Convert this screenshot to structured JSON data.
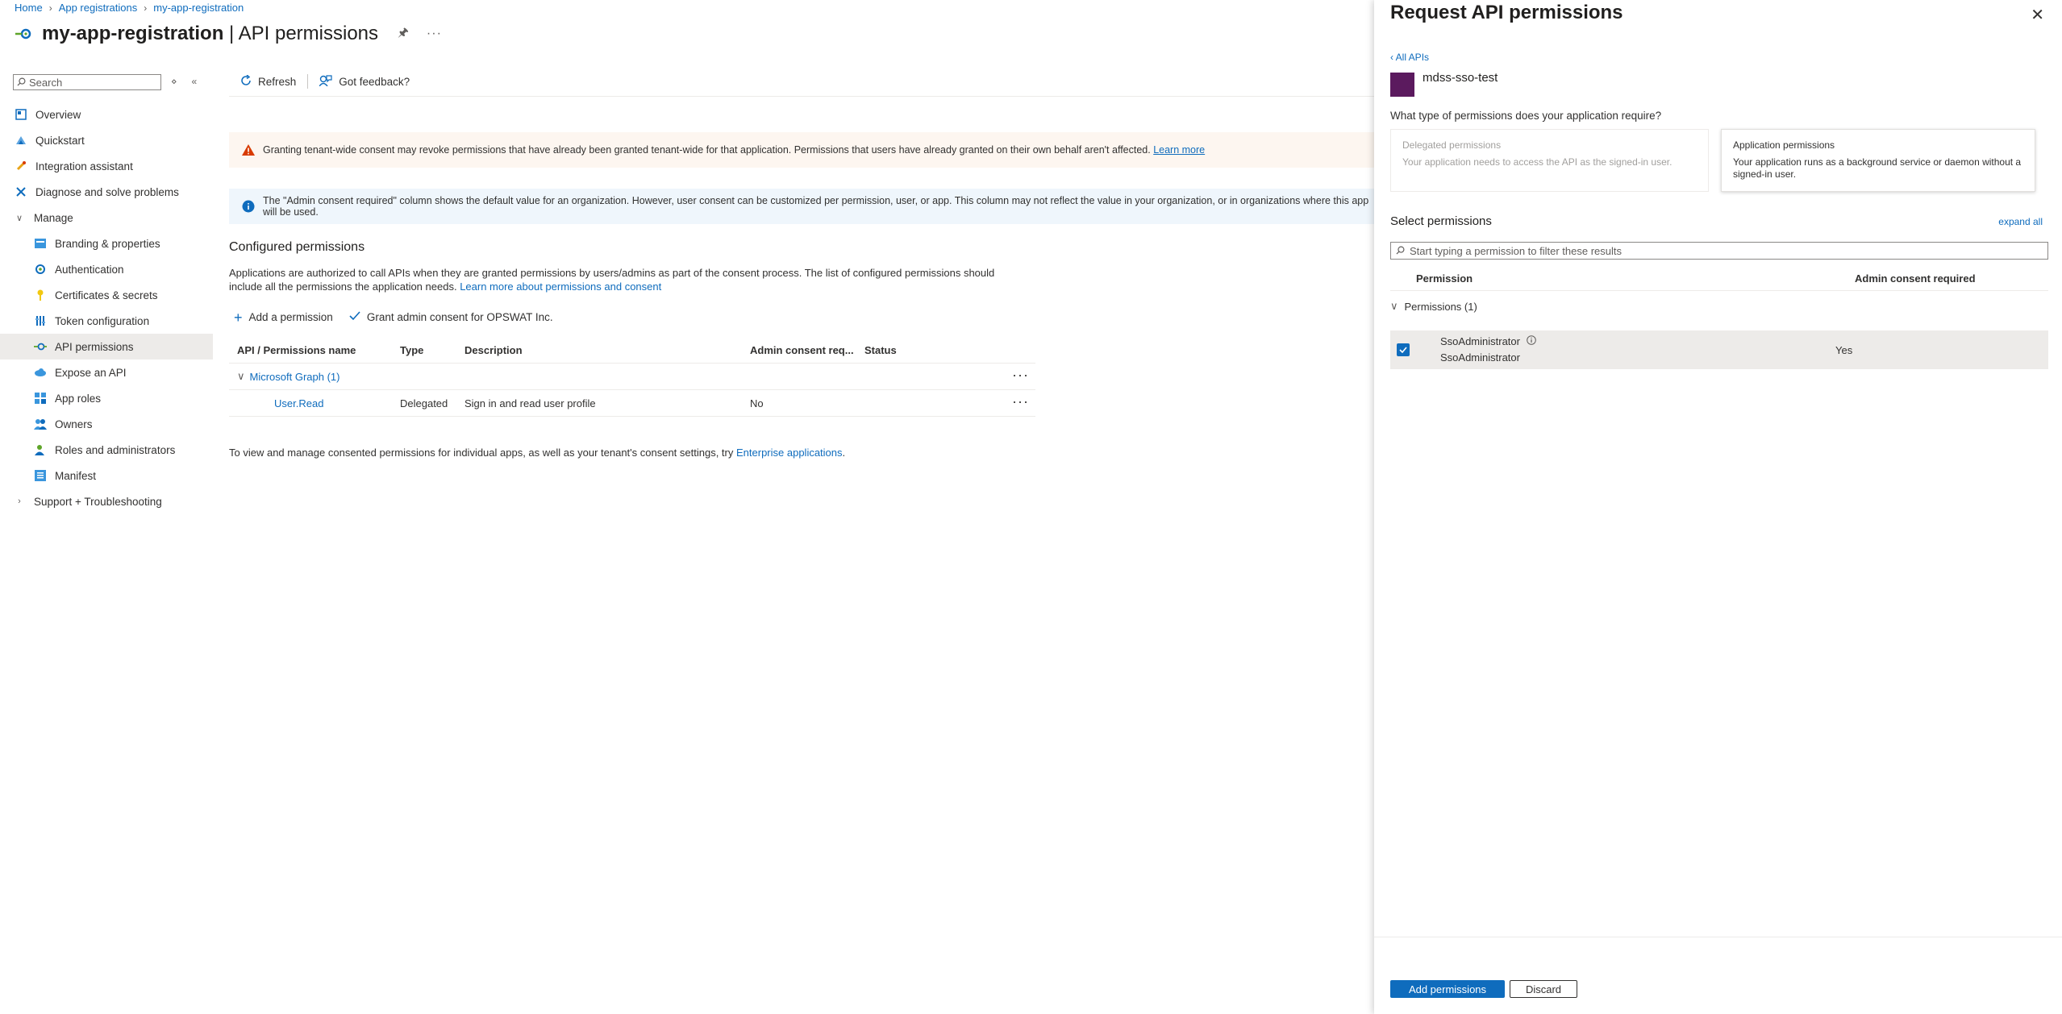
{
  "breadcrumb": [
    "Home",
    "App registrations",
    "my-app-registration"
  ],
  "header": {
    "title": "my-app-registration",
    "subtitle": "API permissions"
  },
  "nav": {
    "search_placeholder": "Search",
    "items": [
      {
        "label": "Overview",
        "icon": "overview-icon"
      },
      {
        "label": "Quickstart",
        "icon": "quickstart-icon"
      },
      {
        "label": "Integration assistant",
        "icon": "rocket-icon"
      },
      {
        "label": "Diagnose and solve problems",
        "icon": "wrench-icon"
      },
      {
        "label": "Manage",
        "icon": "chevron-down-icon"
      },
      {
        "label": "Branding & properties",
        "icon": "branding-icon"
      },
      {
        "label": "Authentication",
        "icon": "authentication-icon"
      },
      {
        "label": "Certificates & secrets",
        "icon": "key-icon"
      },
      {
        "label": "Token configuration",
        "icon": "token-icon"
      },
      {
        "label": "API permissions",
        "icon": "api-permissions-icon"
      },
      {
        "label": "Expose an API",
        "icon": "cloud-icon"
      },
      {
        "label": "App roles",
        "icon": "app-roles-icon"
      },
      {
        "label": "Owners",
        "icon": "owners-icon"
      },
      {
        "label": "Roles and administrators",
        "icon": "roles-icon"
      },
      {
        "label": "Manifest",
        "icon": "manifest-icon"
      },
      {
        "label": "Support + Troubleshooting",
        "icon": "chevron-right-icon"
      }
    ]
  },
  "toolbar": {
    "refresh": "Refresh",
    "feedback": "Got feedback?"
  },
  "banners": {
    "warning_text": "Granting tenant-wide consent may revoke permissions that have already been granted tenant-wide for that application. Permissions that users have already granted on their own behalf aren't affected.",
    "warning_link": "Learn more",
    "info_text": "The \"Admin consent required\" column shows the default value for an organization. However, user consent can be customized per permission, user, or app. This column may not reflect the value in your organization, or in organizations where this app will be used."
  },
  "configured": {
    "title": "Configured permissions",
    "desc": "Applications are authorized to call APIs when they are granted permissions by users/admins as part of the consent process. The list of configured permissions should include all the permissions the application needs.",
    "desc_link": "Learn more about permissions and consent",
    "add_permission": "Add a permission",
    "grant_consent": "Grant admin consent for OPSWAT Inc.",
    "columns": [
      "API / Permissions name",
      "Type",
      "Description",
      "Admin consent req...",
      "Status"
    ],
    "group": "Microsoft Graph (1)",
    "rows": [
      {
        "name": "User.Read",
        "type": "Delegated",
        "description": "Sign in and read user profile",
        "admin": "No",
        "status": ""
      }
    ],
    "footer_text": "To view and manage consented permissions for individual apps, as well as your tenant's consent settings, try",
    "footer_link": "Enterprise applications",
    "footer_end": "."
  },
  "panel": {
    "title": "Request API permissions",
    "all_apis": "All APIs",
    "api_name": "mdss-sso-test",
    "question": "What type of permissions does your application require?",
    "delegated_title": "Delegated permissions",
    "delegated_desc": "Your application needs to access the API as the signed-in user.",
    "application_title": "Application permissions",
    "application_desc": "Your application runs as a background service or daemon without a signed-in user.",
    "select_title": "Select permissions",
    "expand_all": "expand all",
    "filter_placeholder": "Start typing a permission to filter these results",
    "col_permission": "Permission",
    "col_admin": "Admin consent required",
    "group": "Permissions (1)",
    "perm_name": "SsoAdministrator",
    "perm_desc": "SsoAdministrator",
    "perm_admin": "Yes",
    "add_button": "Add permissions",
    "discard_button": "Discard"
  },
  "colors": {
    "accent": "#0f6cbd",
    "warning": "#d83b01",
    "api_tile": "#5b1a5e"
  }
}
